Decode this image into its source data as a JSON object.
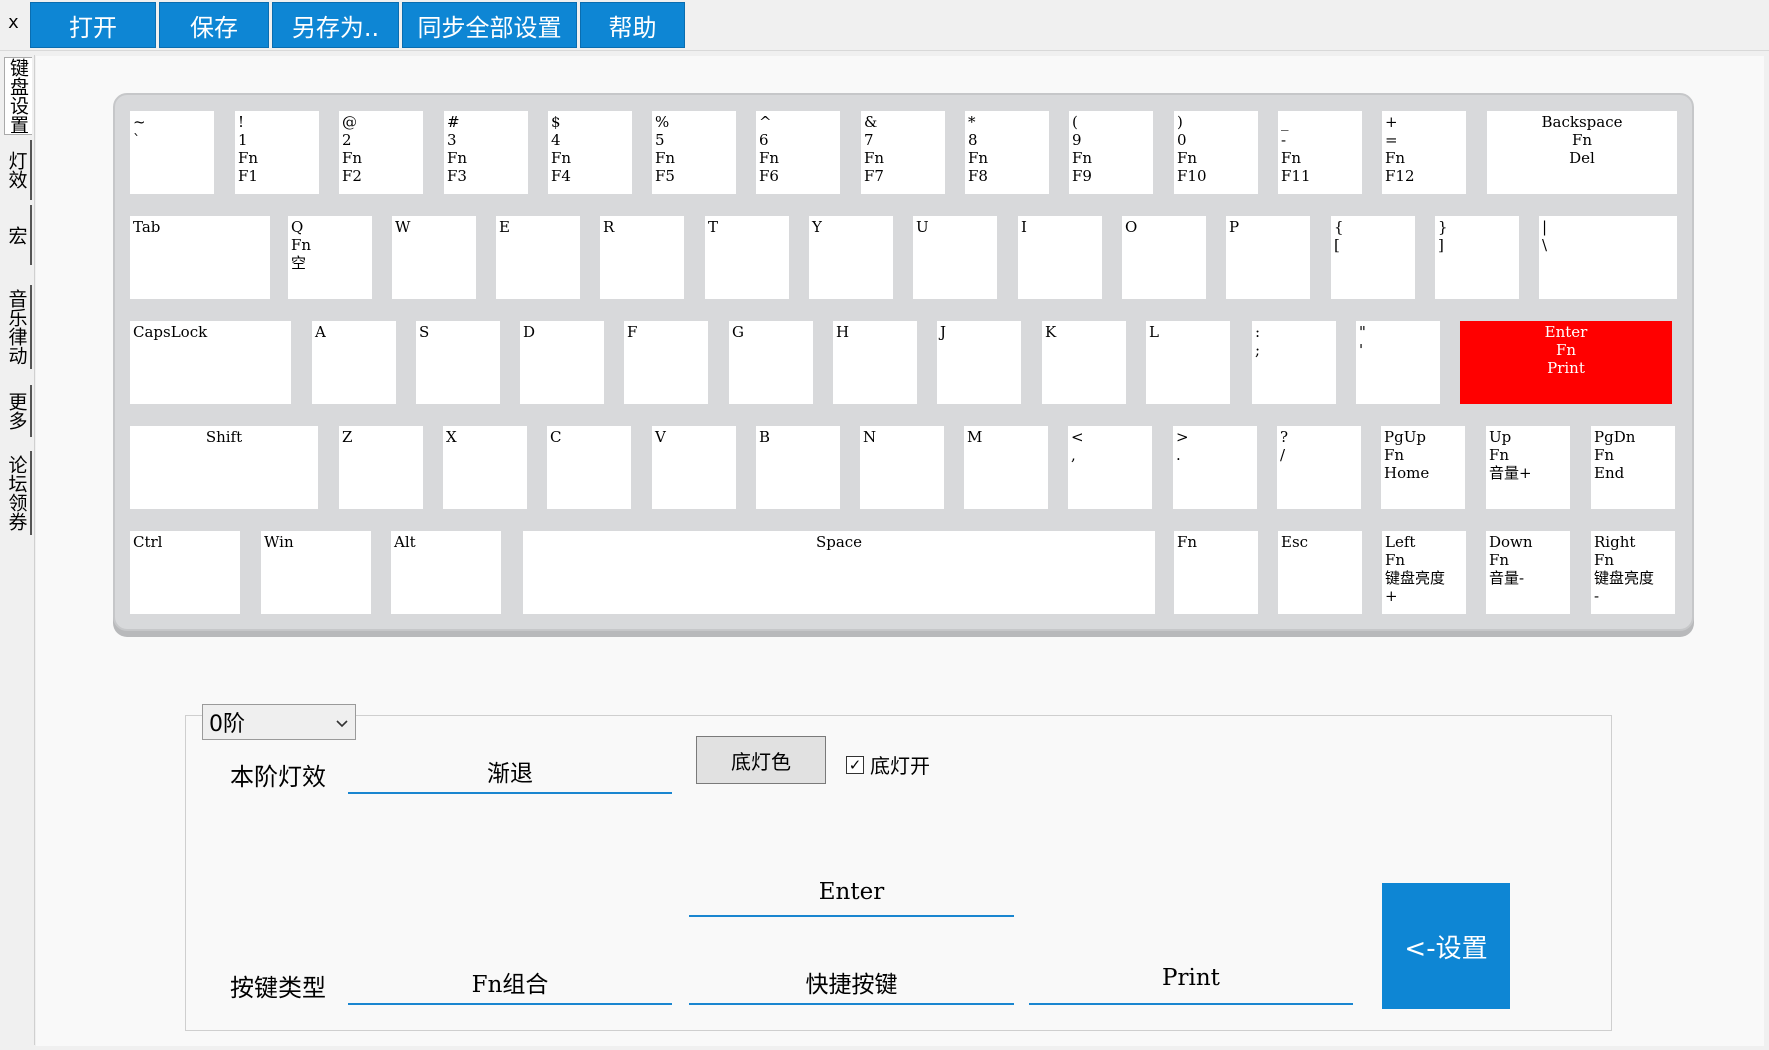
{
  "window": {
    "close_label": "x"
  },
  "toolbar": {
    "buttons": [
      {
        "label": "打开"
      },
      {
        "label": "保存"
      },
      {
        "label": "另存为.."
      },
      {
        "label": "同步全部设置"
      },
      {
        "label": "帮助"
      }
    ]
  },
  "sidebar": {
    "tabs": [
      {
        "label": "键盘设置",
        "active": true
      },
      {
        "label": "灯效"
      },
      {
        "label": "宏"
      },
      {
        "label": "音乐律动"
      },
      {
        "label": "更多"
      },
      {
        "label": "论坛领券"
      }
    ]
  },
  "keyboard": {
    "selected_key": "Enter",
    "selected_color": "#ff0000",
    "rows": [
      [
        "~\n`",
        "!\n1\nFn\nF1",
        "@\n2\nFn\nF2",
        "#\n3\nFn\nF3",
        "$\n4\nFn\nF4",
        "%\n5\nFn\nF5",
        "^\n6\nFn\nF6",
        "&\n7\nFn\nF7",
        "*\n8\nFn\nF8",
        "(\n9\nFn\nF9",
        ")\n0\nFn\nF10",
        "_\n-\nFn\nF11",
        "+\n=\nFn\nF12",
        "Backspace\nFn\nDel"
      ],
      [
        "Tab",
        "Q\nFn\n空",
        "W",
        "E",
        "R",
        "T",
        "Y",
        "U",
        "I",
        "O",
        "P",
        "{\n[",
        "}\n]",
        "|\n\\"
      ],
      [
        "CapsLock",
        "A",
        "S",
        "D",
        "F",
        "G",
        "H",
        "J",
        "K",
        "L",
        ":\n;",
        "\"\n'",
        "Enter\nFn\nPrint"
      ],
      [
        "Shift",
        "Z",
        "X",
        "C",
        "V",
        "B",
        "N",
        "M",
        "<\n,",
        ">\n.",
        "?\n/",
        "PgUp\nFn\nHome",
        "Up\nFn\n音量+",
        "PgDn\nFn\nEnd"
      ],
      [
        "Ctrl",
        "Win",
        "Alt",
        "Space",
        "Fn",
        "Esc",
        "Left\nFn\n键盘亮度\n+",
        "Down\nFn\n音量-",
        "Right\nFn\n键盘亮度\n-"
      ]
    ]
  },
  "settings": {
    "layer_select": {
      "value": "0阶"
    },
    "layer_effect_label": "本阶灯效",
    "layer_effect_value": "渐退",
    "base_color_button": "底灯色",
    "base_light_checkbox": {
      "label": "底灯开",
      "checked": true
    },
    "key_value": "Enter",
    "key_type_label": "按键类型",
    "key_type_value": "Fn组合",
    "shortcut_value": "快捷按键",
    "fn_value": "Print",
    "set_button": "<-设置"
  }
}
